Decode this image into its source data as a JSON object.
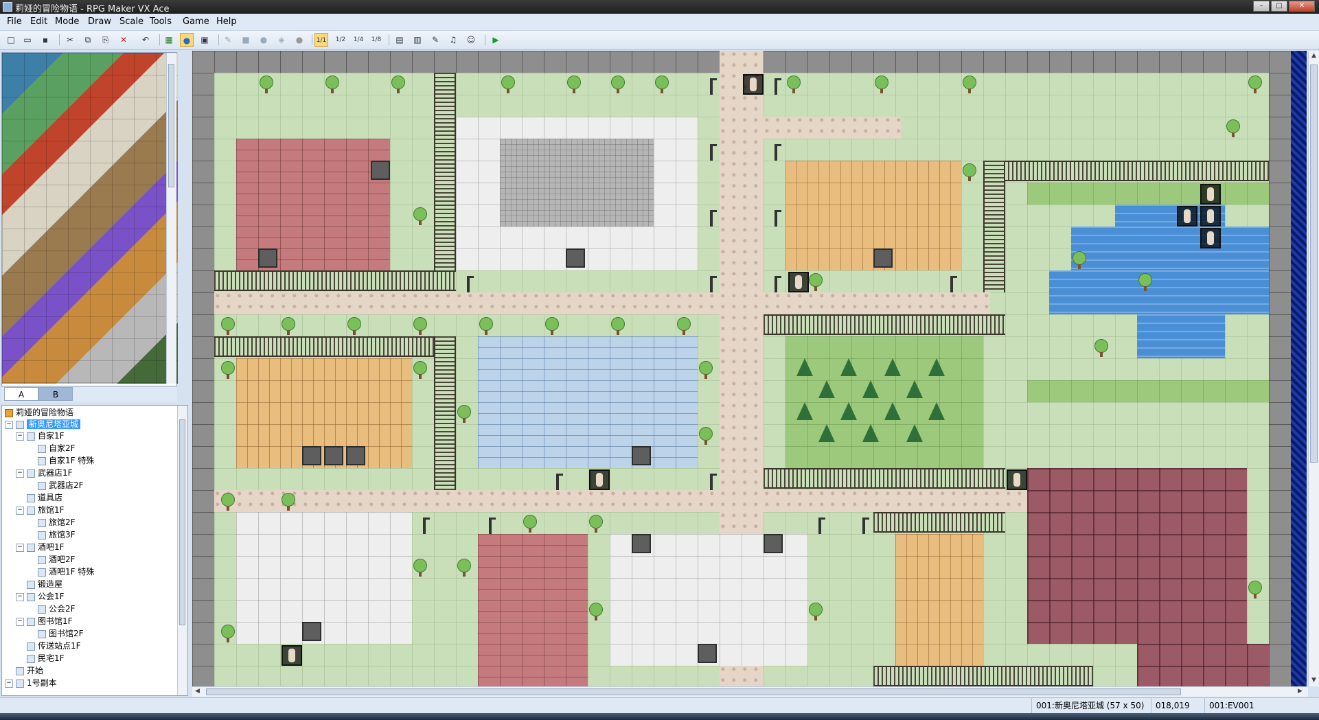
{
  "window": {
    "title": "莉娅的冒险物语 - RPG Maker VX Ace",
    "controls": [
      "–",
      "□",
      "✕"
    ]
  },
  "menu": [
    "File",
    "Edit",
    "Mode",
    "Draw",
    "Scale",
    "Tools",
    "Game",
    "Help"
  ],
  "toolbar": {
    "buttons": [
      {
        "name": "new-project",
        "glyph": "□"
      },
      {
        "name": "open-project",
        "glyph": "▭"
      },
      {
        "name": "save-project",
        "glyph": "▪"
      },
      {
        "name": "cut",
        "glyph": "✂"
      },
      {
        "name": "copy",
        "glyph": "⧉"
      },
      {
        "name": "paste",
        "glyph": "⎘"
      },
      {
        "name": "delete",
        "glyph": "✕"
      },
      {
        "name": "undo",
        "glyph": "↶"
      },
      {
        "name": "map-mode",
        "glyph": "▦"
      },
      {
        "name": "event-mode",
        "glyph": "●"
      },
      {
        "name": "region-mode",
        "glyph": "▣"
      },
      {
        "name": "pencil",
        "glyph": "✎"
      },
      {
        "name": "rectangle",
        "glyph": "■"
      },
      {
        "name": "ellipse",
        "glyph": "●"
      },
      {
        "name": "flood-fill",
        "glyph": "◈"
      },
      {
        "name": "shadow-pen",
        "glyph": "●"
      },
      {
        "name": "scale-1-1",
        "glyph": "1/1"
      },
      {
        "name": "scale-1-2",
        "glyph": "1/2"
      },
      {
        "name": "scale-1-4",
        "glyph": "1/4"
      },
      {
        "name": "scale-1-8",
        "glyph": "1/8"
      },
      {
        "name": "database",
        "glyph": "▤"
      },
      {
        "name": "resource-manager",
        "glyph": "▥"
      },
      {
        "name": "script-editor",
        "glyph": "✎"
      },
      {
        "name": "sound-test",
        "glyph": "♫"
      },
      {
        "name": "character-generator",
        "glyph": "☺"
      },
      {
        "name": "playtest",
        "glyph": "▶"
      }
    ]
  },
  "tileset_tabs": [
    "A",
    "B"
  ],
  "map_tree": [
    {
      "label": "莉娅的冒险物语",
      "level": 0,
      "type": "root"
    },
    {
      "label": "新奥尼塔亚城",
      "level": 0,
      "type": "map",
      "expanded": true,
      "selected": true
    },
    {
      "label": "自家1F",
      "level": 1,
      "type": "map",
      "expanded": true
    },
    {
      "label": "自家2F",
      "level": 2,
      "type": "map"
    },
    {
      "label": "自家1F 特殊",
      "level": 2,
      "type": "map"
    },
    {
      "label": "武器店1F",
      "level": 1,
      "type": "map",
      "expanded": true
    },
    {
      "label": "武器店2F",
      "level": 2,
      "type": "map"
    },
    {
      "label": "道具店",
      "level": 1,
      "type": "map"
    },
    {
      "label": "旅馆1F",
      "level": 1,
      "type": "map",
      "expanded": true
    },
    {
      "label": "旅馆2F",
      "level": 2,
      "type": "map"
    },
    {
      "label": "旅馆3F",
      "level": 2,
      "type": "map"
    },
    {
      "label": "酒吧1F",
      "level": 1,
      "type": "map",
      "expanded": true
    },
    {
      "label": "酒吧2F",
      "level": 2,
      "type": "map"
    },
    {
      "label": "酒吧1F 特殊",
      "level": 2,
      "type": "map"
    },
    {
      "label": "锻造屋",
      "level": 1,
      "type": "map"
    },
    {
      "label": "公会1F",
      "level": 1,
      "type": "map",
      "expanded": true
    },
    {
      "label": "公会2F",
      "level": 2,
      "type": "map"
    },
    {
      "label": "图书馆1F",
      "level": 1,
      "type": "map",
      "expanded": true
    },
    {
      "label": "图书馆2F",
      "level": 2,
      "type": "map"
    },
    {
      "label": "传送站点1F",
      "level": 1,
      "type": "map"
    },
    {
      "label": "民宅1F",
      "level": 1,
      "type": "map"
    },
    {
      "label": "开始",
      "level": 0,
      "type": "map"
    },
    {
      "label": "1号副本",
      "level": 0,
      "type": "map",
      "expanded": true
    }
  ],
  "status": {
    "map_info": "001:新奥尼塔亚城 (57 x 50)",
    "coordinates": "018,019",
    "event": "001:EV001"
  }
}
